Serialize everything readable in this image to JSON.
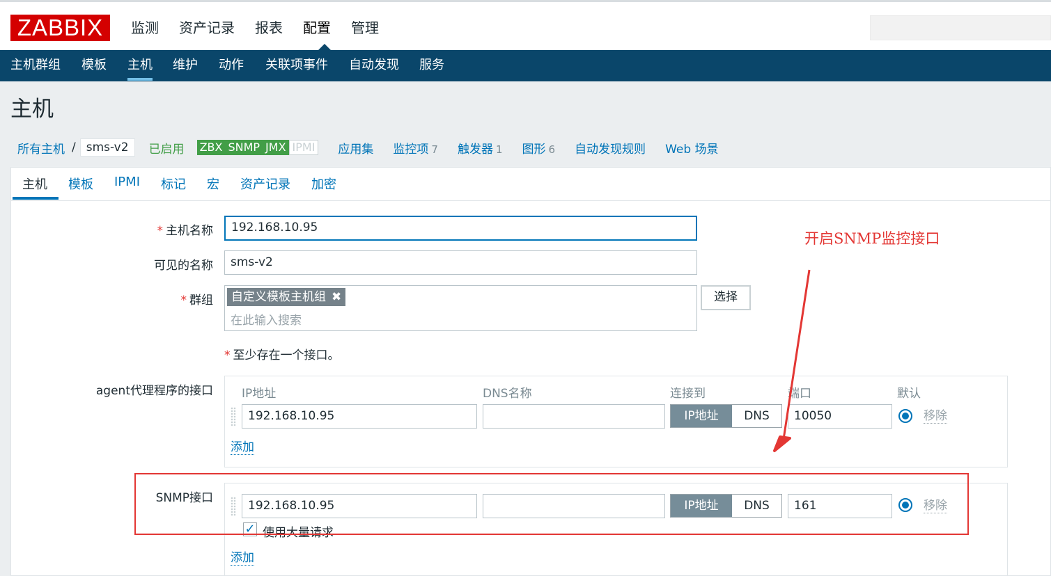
{
  "logo": "ZABBIX",
  "top_menu": [
    "监测",
    "资产记录",
    "报表",
    "配置",
    "管理"
  ],
  "sub_menu": [
    "主机群组",
    "模板",
    "主机",
    "维护",
    "动作",
    "关联项事件",
    "自动发现",
    "服务"
  ],
  "page_title": "主机",
  "host_bar": {
    "all_hosts": "所有主机",
    "separator": "/",
    "current": "sms-v2",
    "status": "已启用",
    "availability": [
      "ZBX",
      "SNMP",
      "JMX",
      "IPMI"
    ],
    "links": [
      {
        "label": "应用集",
        "count": ""
      },
      {
        "label": "监控项",
        "count": "7"
      },
      {
        "label": "触发器",
        "count": "1"
      },
      {
        "label": "图形",
        "count": "6"
      },
      {
        "label": "自动发现规则",
        "count": ""
      },
      {
        "label": "Web 场景",
        "count": ""
      }
    ]
  },
  "tabs": [
    "主机",
    "模板",
    "IPMI",
    "标记",
    "宏",
    "资产记录",
    "加密"
  ],
  "form": {
    "host_name_label": "主机名称",
    "host_name_value": "192.168.10.95",
    "visible_name_label": "可见的名称",
    "visible_name_value": "sms-v2",
    "groups_label": "群组",
    "group_tag": "自定义模板主机组",
    "group_placeholder": "在此输入搜索",
    "select_button": "选择",
    "required_star": "*",
    "interface_notice": "至少存在一个接口。",
    "agent_label": "agent代理程序的接口",
    "snmp_label": "SNMP接口",
    "columns": {
      "ip": "IP地址",
      "dns": "DNS名称",
      "connect": "连接到",
      "port": "端口",
      "default": "默认"
    },
    "agent": {
      "ip": "192.168.10.95",
      "dns": "",
      "conn_ip": "IP地址",
      "conn_dns": "DNS",
      "port": "10050",
      "remove": "移除"
    },
    "snmp": {
      "ip": "192.168.10.95",
      "dns": "",
      "conn_ip": "IP地址",
      "conn_dns": "DNS",
      "port": "161",
      "remove": "移除",
      "bulk": "使用大量请求"
    },
    "add": "添加"
  },
  "annotation": "开启SNMP监控接口",
  "colors": {
    "brand": "#d40000",
    "nav": "#0a466a",
    "link": "#0275b8",
    "enabled": "#429e47",
    "annotation": "#e33734"
  }
}
